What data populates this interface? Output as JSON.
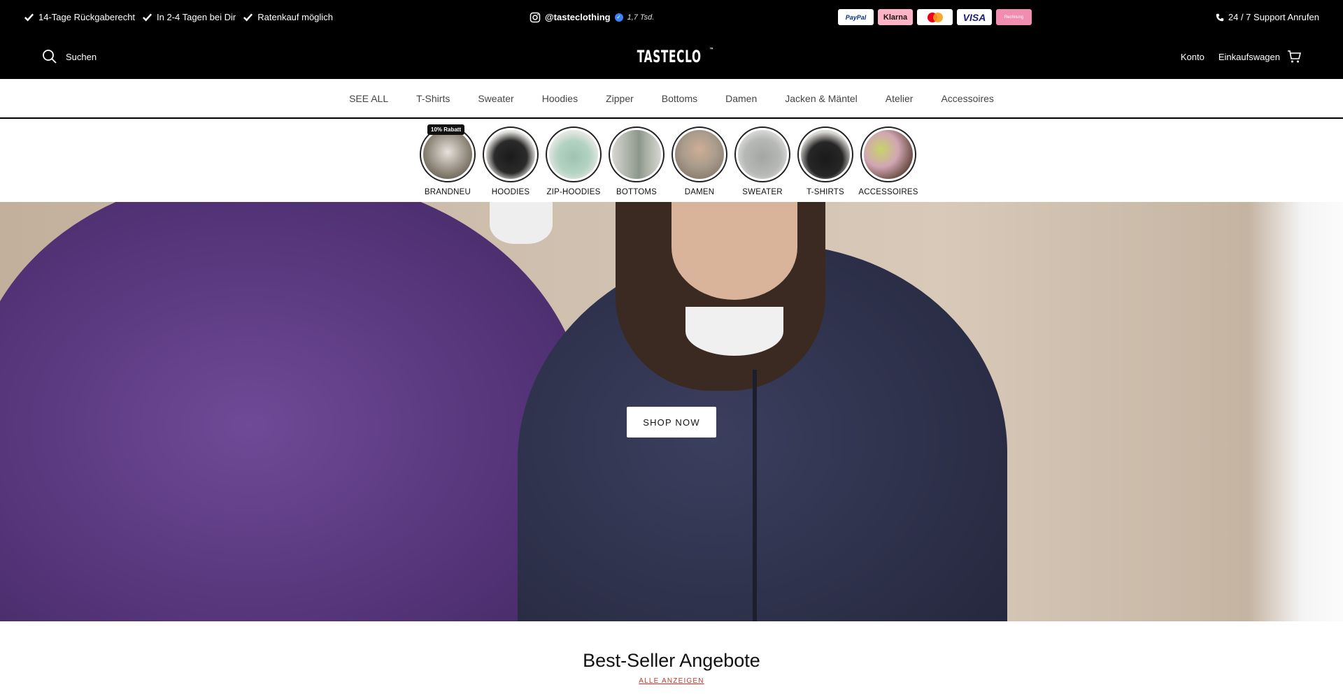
{
  "announcement": {
    "usps": [
      "14-Tage Rückgaberecht",
      "In 2-4 Tagen bei Dir",
      "Ratenkauf möglich"
    ],
    "instagram_handle": "@tasteclothing",
    "instagram_followers": "1,7 Tsd.",
    "payments": [
      "PayPal",
      "Klarna",
      "Mastercard",
      "VISA",
      "Rechnung"
    ],
    "support": "24 / 7 Support Anrufen"
  },
  "header": {
    "search_label": "Suchen",
    "logo": "TASTECLO",
    "logo_mark": "™",
    "account": "Konto",
    "cart": "Einkaufswagen"
  },
  "nav": {
    "items": [
      "SEE ALL",
      "T-Shirts",
      "Sweater",
      "Hoodies",
      "Zipper",
      "Bottoms",
      "Damen",
      "Jacken & Mäntel",
      "Atelier",
      "Accessoires"
    ]
  },
  "categories": {
    "badge": "10% Rabatt",
    "items": [
      {
        "label": "BRANDNEU",
        "color": "#8a8175"
      },
      {
        "label": "HOODIES",
        "color": "#2b2b2b"
      },
      {
        "label": "ZIP-HOODIES",
        "color": "#9fc3b0"
      },
      {
        "label": "BOTTOMS",
        "color": "#a8b0a4"
      },
      {
        "label": "DAMEN",
        "color": "#a99c8c"
      },
      {
        "label": "SWEATER",
        "color": "#b7b9b6"
      },
      {
        "label": "T-SHIRTS",
        "color": "#262626"
      },
      {
        "label": "ACCESSOIRES",
        "color": "#d1a6b4"
      }
    ]
  },
  "hero": {
    "cta": "SHOP NOW"
  },
  "bestseller": {
    "title": "Best-Seller Angebote",
    "link": "ALLE ANZEIGEN"
  }
}
